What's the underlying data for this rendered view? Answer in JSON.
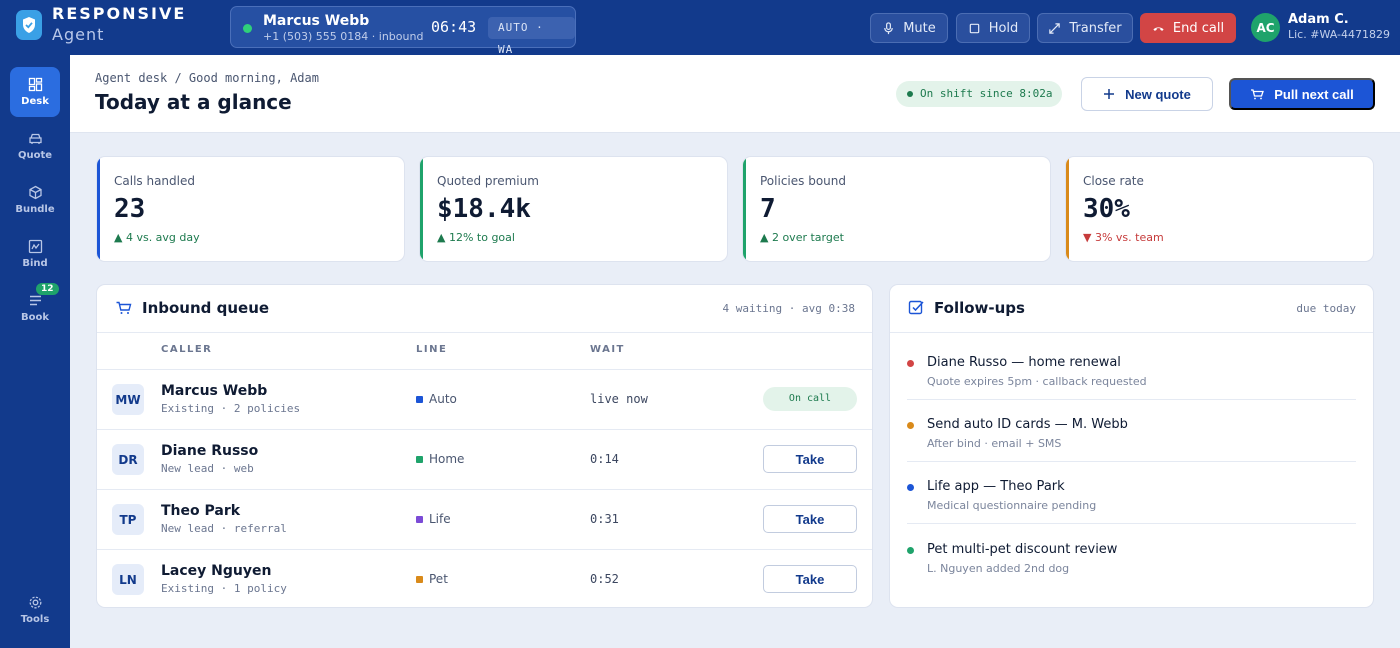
{
  "app": {
    "name": "RESPONSIVE",
    "subtitle": "Agent"
  },
  "call": {
    "caller": "Marcus Webb",
    "details": "+1 (503) 555 0184 · inbound",
    "timer": "06:43",
    "tag": "AUTO · WA",
    "status_color": "#2fd07a"
  },
  "call_controls": {
    "mute": "Mute",
    "hold": "Hold",
    "transfer": "Transfer",
    "end": "End call"
  },
  "user": {
    "initials": "AC",
    "name": "Adam C.",
    "license": "Lic. #WA-4471829"
  },
  "sidenav": {
    "items": [
      {
        "label": "Desk",
        "icon": "dashboard-icon",
        "active": true
      },
      {
        "label": "Quote",
        "icon": "car-icon"
      },
      {
        "label": "Bundle",
        "icon": "cube-icon"
      },
      {
        "label": "Bind",
        "icon": "signature-icon"
      },
      {
        "label": "Book",
        "icon": "list-icon",
        "badge": "12"
      }
    ],
    "tools": {
      "label": "Tools",
      "icon": "gear-icon"
    }
  },
  "header": {
    "breadcrumb": "Agent desk / Good morning, Adam",
    "title": "Today at a glance",
    "shift": "On shift since 8:02a",
    "new_quote": "New quote",
    "pull_next": "Pull next call"
  },
  "stats": [
    {
      "label": "Calls handled",
      "value": "23",
      "delta": "▲ 4 vs. avg day",
      "accent": "#1c55d6",
      "delta_color": "#1d7a4e"
    },
    {
      "label": "Quoted premium",
      "value": "$18.4k",
      "delta": "▲ 12% to goal",
      "accent": "#1fa36b",
      "delta_color": "#1d7a4e"
    },
    {
      "label": "Policies bound",
      "value": "7",
      "delta": "▲ 2 over target",
      "accent": "#1fa36b",
      "delta_color": "#1d7a4e"
    },
    {
      "label": "Close rate",
      "value": "30%",
      "delta": "▼ 3% vs. team",
      "accent": "#d98a1a",
      "delta_color": "#c63b3b"
    }
  ],
  "queue": {
    "title": "Inbound queue",
    "meta": "4 waiting · avg 0:38",
    "columns": [
      "CALLER",
      "LINE",
      "WAIT"
    ],
    "take_label": "Take",
    "oncall_label": "On call",
    "rows": [
      {
        "initials": "MW",
        "name": "Marcus Webb",
        "sub": "Existing · 2 policies",
        "line": "Auto",
        "line_color": "#1c55d6",
        "wait": "live now"
      },
      {
        "initials": "DR",
        "name": "Diane Russo",
        "sub": "New lead · web",
        "line": "Home",
        "line_color": "#1fa36b",
        "wait": "0:14"
      },
      {
        "initials": "TP",
        "name": "Theo Park",
        "sub": "New lead · referral",
        "line": "Life",
        "line_color": "#7b4bd6",
        "wait": "0:31"
      },
      {
        "initials": "LN",
        "name": "Lacey Nguyen",
        "sub": "Existing · 1 policy",
        "line": "Pet",
        "line_color": "#d98a1a",
        "wait": "0:52"
      }
    ]
  },
  "followups": {
    "title": "Follow-ups",
    "meta": "due today",
    "items": [
      {
        "title": "Diane Russo — home renewal",
        "sub": "Quote expires 5pm · callback requested",
        "color": "#d24545"
      },
      {
        "title": "Send auto ID cards — M. Webb",
        "sub": "After bind · email + SMS",
        "color": "#d98a1a"
      },
      {
        "title": "Life app — Theo Park",
        "sub": "Medical questionnaire pending",
        "color": "#1c55d6"
      },
      {
        "title": "Pet multi-pet discount review",
        "sub": "L. Nguyen added 2nd dog",
        "color": "#1fa36b"
      }
    ]
  }
}
